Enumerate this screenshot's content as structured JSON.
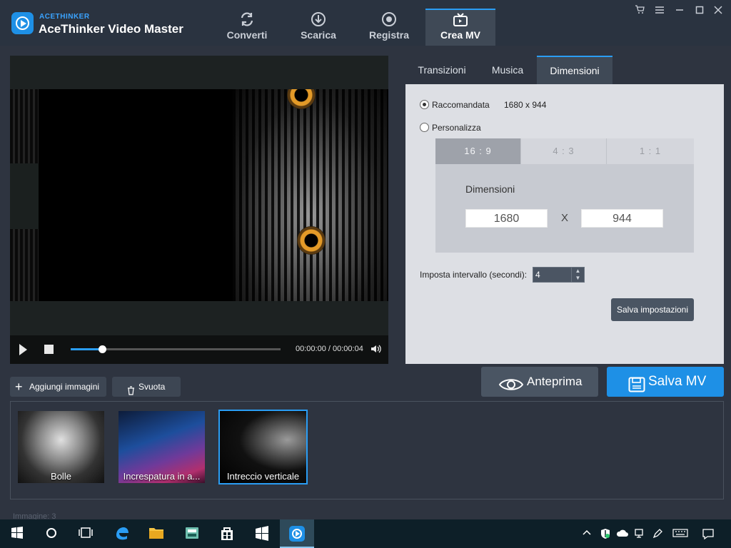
{
  "app": {
    "brand_small": "ACETHINKER",
    "brand_title": "AceThinker Video Master"
  },
  "nav": {
    "tabs": [
      {
        "label": "Converti",
        "icon": "refresh-icon"
      },
      {
        "label": "Scarica",
        "icon": "download-icon"
      },
      {
        "label": "Registra",
        "icon": "record-icon"
      },
      {
        "label": "Crea MV",
        "icon": "tv-icon",
        "active": true
      }
    ]
  },
  "player": {
    "time": "00:00:00 / 00:00:04",
    "progress": 0.15
  },
  "settings": {
    "tabs": [
      "Transizioni",
      "Musica",
      "Dimensioni"
    ],
    "active_tab": "Dimensioni",
    "recommended_label": "Raccomandata",
    "recommended_value": "1680 x 944",
    "custom_label": "Personalizza",
    "ratios": [
      "16 : 9",
      "4 : 3",
      "1 : 1"
    ],
    "dimensions_label": "Dimensioni",
    "width": "1680",
    "x_sep": "X",
    "height": "944",
    "interval_label": "Imposta intervallo (secondi):",
    "interval_value": "4",
    "save_settings": "Salva impostazioni"
  },
  "toolbar": {
    "add_images": "Aggiungi immagini",
    "clear": "Svuota",
    "preview": "Anteprima",
    "save_mv": "Salva MV"
  },
  "images": [
    {
      "caption": "Bolle"
    },
    {
      "caption": "Increspatura in a..."
    },
    {
      "caption": "Intreccio verticale",
      "selected": true
    }
  ],
  "status": "Immagine: 3",
  "colors": {
    "accent": "#1e90e6",
    "panel_bg": "#dddfe4",
    "app_bg": "#2e3440"
  }
}
